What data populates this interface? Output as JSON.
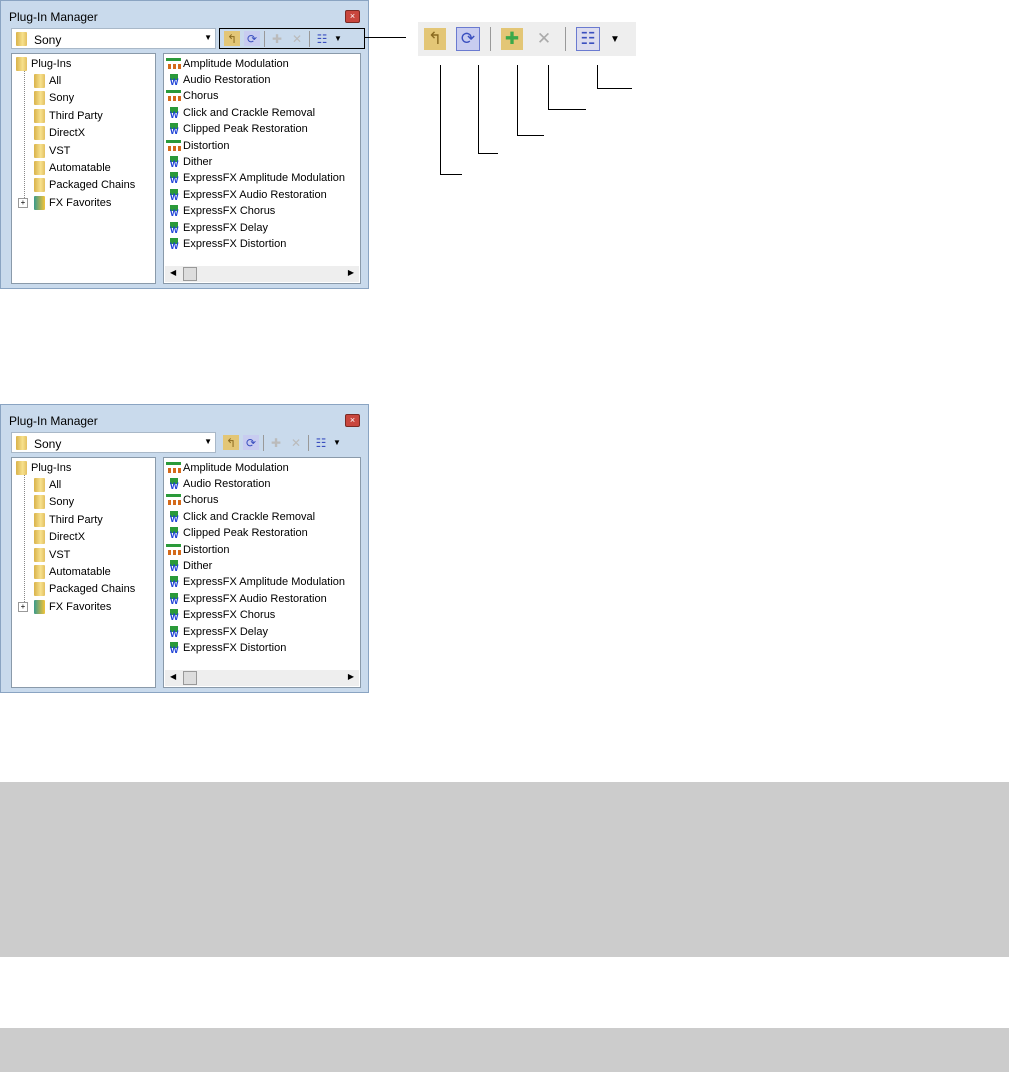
{
  "window": {
    "title": "Plug-In Manager",
    "close_icon": "×",
    "combo_value": "Sony"
  },
  "toolbar": {
    "up_folder": "↰",
    "refresh": "⟳",
    "new_folder": "✚",
    "delete": "✕",
    "view": "☷",
    "dropdown": "▼"
  },
  "tree": [
    "Plug-Ins",
    "All",
    "Sony",
    "Third Party",
    "DirectX",
    "VST",
    "Automatable",
    "Packaged Chains",
    "FX Favorites"
  ],
  "plugins": [
    {
      "name": "Amplitude Modulation",
      "type": "a"
    },
    {
      "name": "Audio Restoration",
      "type": "b"
    },
    {
      "name": "Chorus",
      "type": "a"
    },
    {
      "name": "Click and Crackle Removal",
      "type": "b"
    },
    {
      "name": "Clipped Peak Restoration",
      "type": "b"
    },
    {
      "name": "Distortion",
      "type": "a"
    },
    {
      "name": "Dither",
      "type": "b"
    },
    {
      "name": "ExpressFX Amplitude Modulation",
      "type": "b"
    },
    {
      "name": "ExpressFX Audio Restoration",
      "type": "b"
    },
    {
      "name": "ExpressFX Chorus",
      "type": "b"
    },
    {
      "name": "ExpressFX Delay",
      "type": "b"
    },
    {
      "name": "ExpressFX Distortion",
      "type": "b"
    }
  ],
  "colors": {
    "frame": "#c9daec",
    "gray_block": "#cccccc"
  }
}
